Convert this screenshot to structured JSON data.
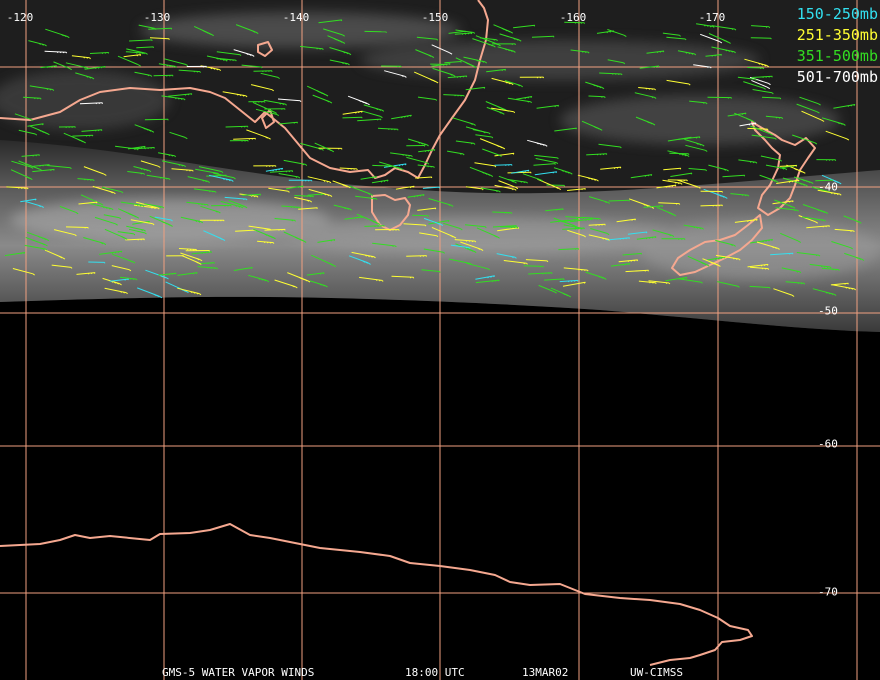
{
  "map": {
    "lon_labels": [
      "-120",
      "-130",
      "-140",
      "-150",
      "-160",
      "-170"
    ],
    "lat_labels": [
      "-40",
      "-50",
      "-60",
      "-70"
    ],
    "colors": {
      "grid": "#f0a080",
      "coast": "#f5a890",
      "cyan": "#33e0f0",
      "yellow": "#ffff33",
      "green": "#33dd22",
      "white": "#ffffff"
    }
  },
  "legend": [
    {
      "label": "150-250mb",
      "color": "#33e0f0"
    },
    {
      "label": "251-350mb",
      "color": "#ffff33"
    },
    {
      "label": "351-500mb",
      "color": "#33dd22"
    },
    {
      "label": "501-700mb",
      "color": "#ffffff"
    }
  ],
  "footer": {
    "satellite": "GMS-5 WATER VAPOR WINDS",
    "time": "18:00 UTC",
    "date": "13MAR02",
    "source": "UW-CIMSS"
  }
}
